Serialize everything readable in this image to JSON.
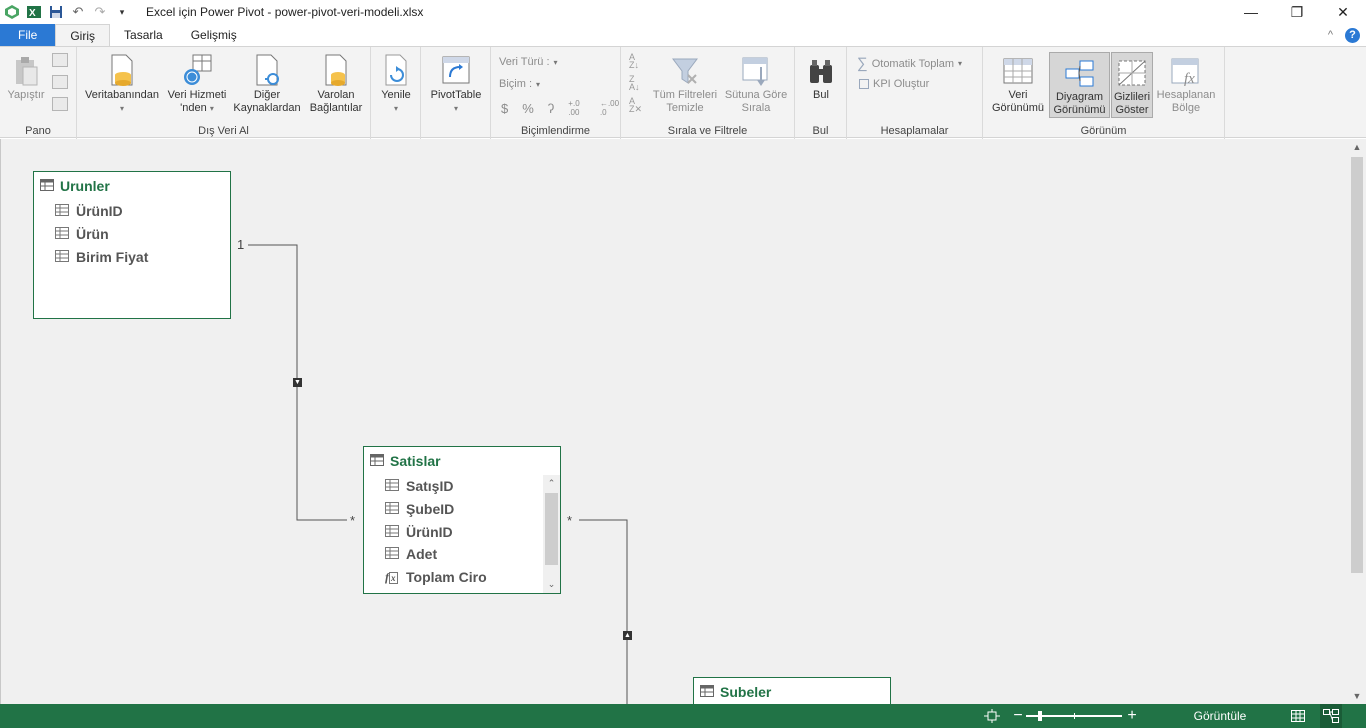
{
  "titlebar": {
    "title": "Excel için Power Pivot - power-pivot-veri-modeli.xlsx",
    "qat_icons": [
      "power-pivot-logo-icon",
      "excel-icon",
      "save-icon",
      "undo-icon",
      "redo-icon",
      "customize-qat-icon"
    ],
    "minimize": "—",
    "restore": "❐",
    "close": "✕"
  },
  "tabs": {
    "items": [
      "File",
      "Giriş",
      "Tasarla",
      "Gelişmiş"
    ],
    "active": "Giriş",
    "collapse_glyph": "^",
    "help_glyph": "?"
  },
  "ribbon": {
    "pano": {
      "label": "Pano",
      "paste": "Yapıştır"
    },
    "dis_veri_al": {
      "label": "Dış Veri Al",
      "db_line1": "Veritabanından",
      "ws_line1": "Veri Hizmeti",
      "ws_line2": "'nden",
      "other_line1": "Diğer",
      "other_line2": "Kaynaklardan",
      "existing_line1": "Varolan",
      "existing_line2": "Bağlantılar"
    },
    "yenile": {
      "label": "Yenile"
    },
    "pivot": {
      "label": "PivotTable"
    },
    "bicimlendirme": {
      "label": "Biçimlendirme",
      "veri_turu": "Veri Türü :",
      "bicim": "Biçim :",
      "symbols": [
        "$",
        "%",
        "ʔ",
        "+.0 .00",
        "←.00 .0"
      ]
    },
    "sirala": {
      "label": "Sırala ve Filtrele",
      "clear_line1": "Tüm Filtreleri",
      "clear_line2": "Temizle",
      "sort_line1": "Sütuna Göre",
      "sort_line2": "Sırala"
    },
    "bul": {
      "label": "Bul",
      "button": "Bul"
    },
    "hesaplamalar": {
      "label": "Hesaplamalar",
      "autosum": "Otomatik Toplam",
      "kpi": "KPI Oluştur"
    },
    "gorunum": {
      "label": "Görünüm",
      "data_line1": "Veri",
      "data_line2": "Görünümü",
      "diagram_line1": "Diyagram",
      "diagram_line2": "Görünümü",
      "hidden_line1": "Gizlileri",
      "hidden_line2": "Göster",
      "calc_line1": "Hesaplanan",
      "calc_line2": "Bölge"
    }
  },
  "diagram": {
    "tables": [
      {
        "name": "Urunler",
        "fields": [
          {
            "name": "ÜrünID",
            "kind": "column"
          },
          {
            "name": "Ürün",
            "kind": "column"
          },
          {
            "name": "Birim Fiyat",
            "kind": "column"
          }
        ]
      },
      {
        "name": "Satislar",
        "fields": [
          {
            "name": "SatışID",
            "kind": "column"
          },
          {
            "name": "ŞubeID",
            "kind": "column"
          },
          {
            "name": "ÜrünID",
            "kind": "column"
          },
          {
            "name": "Adet",
            "kind": "column"
          },
          {
            "name": "Toplam Ciro",
            "kind": "measure"
          }
        ]
      },
      {
        "name": "Subeler",
        "fields": []
      }
    ],
    "relationships": [
      {
        "from": "Urunler",
        "to": "Satislar",
        "one_label": "1",
        "many_label": "*"
      },
      {
        "from": "Subeler",
        "to": "Satislar",
        "many_label": "*"
      }
    ]
  },
  "statusbar": {
    "zoom_minus": "−",
    "zoom_plus": "+",
    "display_label": "Görüntüle"
  }
}
